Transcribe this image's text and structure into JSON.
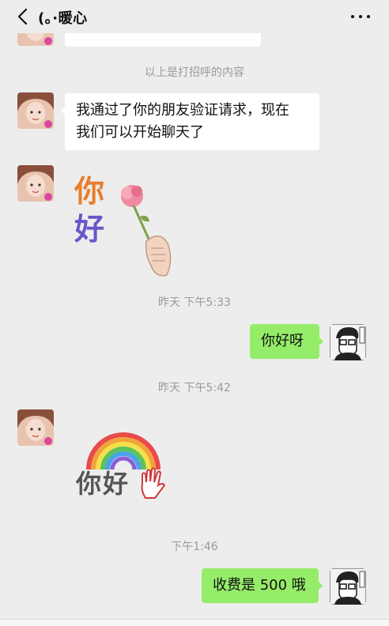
{
  "header": {
    "title": "(｡·暖心",
    "back_icon": "chevron-left-icon",
    "more_icon": "more-dots-icon"
  },
  "system_messages": {
    "greeting_note": "以上是打招呼的内容",
    "time_1": "昨天 下午5:33",
    "time_2": "昨天 下午5:42",
    "time_3": "下午1:46"
  },
  "messages": {
    "verify_line1": "我通过了你的朋友验证请求，现在",
    "verify_line2": "我们可以开始聊天了",
    "reply_1": "你好呀",
    "reply_2": "收费是 500 哦"
  },
  "stickers": {
    "hello_rose_text_1": "你",
    "hello_rose_text_2": "好",
    "hello_rainbow_text": "你好"
  },
  "colors": {
    "background": "#ededed",
    "my_bubble": "#95ec69",
    "their_bubble": "#ffffff",
    "system_text": "#9a9a9a"
  }
}
